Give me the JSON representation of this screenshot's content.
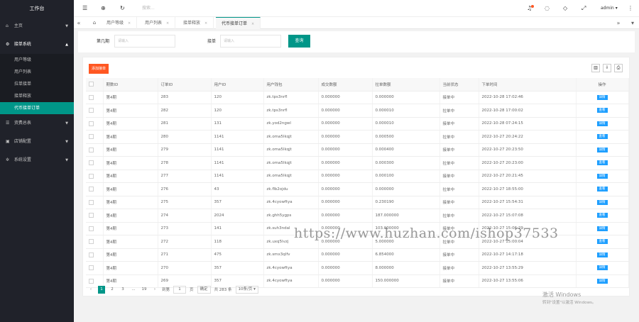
{
  "sidebar": {
    "logo": "工作台",
    "menu": [
      {
        "label": "主页",
        "icon": "home-icon"
      },
      {
        "label": "接单系统",
        "icon": "gear-icon"
      },
      {
        "label": "资费总表",
        "icon": "list-icon"
      },
      {
        "label": "店铺配置",
        "icon": "shop-icon"
      },
      {
        "label": "系统设置",
        "icon": "settings-icon"
      }
    ],
    "submenu": [
      "用户等级",
      "用户列表",
      "拉单接单",
      "接单释放",
      "代币接单订单"
    ]
  },
  "header": {
    "search_placeholder": "搜索...",
    "user": "admin"
  },
  "tabs": [
    "用户等级",
    "用户列表",
    "接单释放",
    "代币接单订单"
  ],
  "search": {
    "field1_label": "第几期",
    "field1_placeholder": "请输入",
    "field2_label": "接单",
    "field2_placeholder": "请输入",
    "button": "查询"
  },
  "table": {
    "add_button": "添加接单",
    "columns": [
      "",
      "期数ID",
      "订单ID",
      "用户ID",
      "用户钱包",
      "成交数额",
      "拉单数额",
      "当前状态",
      "下单时间",
      "操作"
    ],
    "rows": [
      [
        "第4期",
        "283",
        "120",
        "zk.tps3nrfl",
        "0.000000",
        "0.000000",
        "接单中",
        "2022-10-28 17:02:46",
        "详情"
      ],
      [
        "第4期",
        "282",
        "120",
        "zk.tps3nrfl",
        "0.000000",
        "0.000010",
        "拉单中",
        "2022-10-28 17:00:02",
        "查看"
      ],
      [
        "第4期",
        "281",
        "131",
        "zk.yod2ngwl",
        "0.000000",
        "0.000010",
        "接单中",
        "2022-10-28 07:24:15",
        "详情"
      ],
      [
        "第4期",
        "280",
        "1141",
        "zk.oma5lkqjt",
        "0.000000",
        "0.000500",
        "拉单中",
        "2022-10-27 20:24:22",
        "查看"
      ],
      [
        "第4期",
        "279",
        "1141",
        "zk.oma5lkqjt",
        "0.000000",
        "0.000400",
        "接单中",
        "2022-10-27 20:23:50",
        "详情"
      ],
      [
        "第4期",
        "278",
        "1141",
        "zk.oma5lkqjt",
        "0.000000",
        "0.000300",
        "拉单中",
        "2022-10-27 20:23:00",
        "查看"
      ],
      [
        "第4期",
        "277",
        "1141",
        "zk.oma5lkqjt",
        "0.000000",
        "0.000100",
        "接单中",
        "2022-10-27 20:21:45",
        "详情"
      ],
      [
        "第4期",
        "276",
        "43",
        "zk.flb2ojdu",
        "0.000000",
        "0.000000",
        "拉单中",
        "2022-10-27 18:55:00",
        "查看"
      ],
      [
        "第4期",
        "275",
        "357",
        "zk.4cyowftya",
        "0.000000",
        "0.230190",
        "接单中",
        "2022-10-27 15:54:31",
        "详情"
      ],
      [
        "第4期",
        "274",
        "2024",
        "zk.ghh5ygps",
        "0.000000",
        "187.000000",
        "拉单中",
        "2022-10-27 15:07:08",
        "查看"
      ],
      [
        "第4期",
        "273",
        "141",
        "zk.suh3ndal",
        "0.000000",
        "103.000000",
        "接单中",
        "2022-10-27 15:06:29",
        "详情"
      ],
      [
        "第4期",
        "272",
        "118",
        "zk.uxq5lvzj",
        "0.000000",
        "5.000000",
        "拉单中",
        "2022-10-27 15:00:04",
        "查看"
      ],
      [
        "第4期",
        "271",
        "475",
        "zk.smx3qlfv",
        "0.000000",
        "6.854000",
        "接单中",
        "2022-10-27 14:17:18",
        "详情"
      ],
      [
        "第4期",
        "270",
        "357",
        "zk.4cyowftya",
        "0.000000",
        "8.000000",
        "接单中",
        "2022-10-27 13:55:29",
        "详情"
      ],
      [
        "第4期",
        "269",
        "357",
        "zk.4cyowftya",
        "0.000000",
        "150.000000",
        "接单中",
        "2022-10-27 13:55:06",
        "详情"
      ]
    ]
  },
  "pager": {
    "pages": [
      "1",
      "2",
      "3",
      "...",
      "19"
    ],
    "goto_label": "到第",
    "goto_value": "1",
    "page_unit": "页",
    "confirm": "确定",
    "total": "共 283 条",
    "page_size": "10条/页"
  },
  "watermark": "https://www.huzhan.com/ishop37533",
  "windows_activation": {
    "line1": "激活 Windows",
    "line2": "转到\"设置\"以激活 Windows。"
  },
  "colors": {
    "accent": "#009688",
    "danger": "#ff5722",
    "info": "#1e9fff",
    "sidebar": "#20222a"
  }
}
